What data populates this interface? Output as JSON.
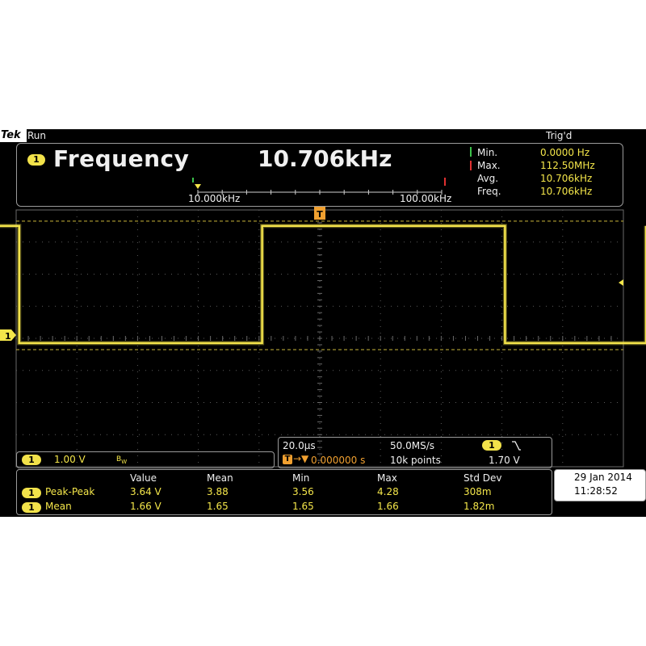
{
  "header": {
    "brand": "Tek",
    "run_state": "Run",
    "trigger_state": "Trig'd"
  },
  "frequency_panel": {
    "channel": "1",
    "title": "Frequency",
    "value": "10.706kHz",
    "scale_min_label": "10.000kHz",
    "scale_max_label": "100.00kHz",
    "stats": [
      {
        "label": "Min.",
        "value": "0.0000 Hz"
      },
      {
        "label": "Max.",
        "value": "112.50MHz"
      },
      {
        "label": "Avg.",
        "value": "10.706kHz"
      },
      {
        "label": "Freq.",
        "value": "10.706kHz"
      }
    ]
  },
  "waveform": {
    "color": "#f2e24a",
    "channel_marker": "1",
    "trigger_marker": "T",
    "high_level_v": 3.4,
    "low_level_v": -0.25,
    "volts_per_div": 1.0,
    "time_per_div_us": 20.0,
    "transitions_div": [
      -4.95,
      -0.95,
      3.05,
      7.05,
      8.0
    ]
  },
  "channel_settings": {
    "channel": "1",
    "volts_per_div": "1.00 V",
    "bandwidth_icon": "BW-limit-icon"
  },
  "timebase": {
    "time_per_div": "20.0µs",
    "sample_rate": "50.0MS/s",
    "trigger_position": "0.000000 s",
    "record_length": "10k points",
    "trigger_channel": "1",
    "trigger_slope_icon": "falling-edge-icon",
    "trigger_level": "1.70 V"
  },
  "measurements": {
    "headers": [
      "Value",
      "Mean",
      "Min",
      "Max",
      "Std Dev"
    ],
    "rows": [
      {
        "channel": "1",
        "name": "Peak-Peak",
        "value": "3.64 V",
        "mean": "3.88",
        "min": "3.56",
        "max": "4.28",
        "std": "308m"
      },
      {
        "channel": "1",
        "name": "Mean",
        "value": "1.66 V",
        "mean": "1.65",
        "min": "1.65",
        "max": "1.66",
        "std": "1.82m"
      }
    ]
  },
  "datetime": {
    "date": "29 Jan  2014",
    "time": "11:28:52"
  }
}
